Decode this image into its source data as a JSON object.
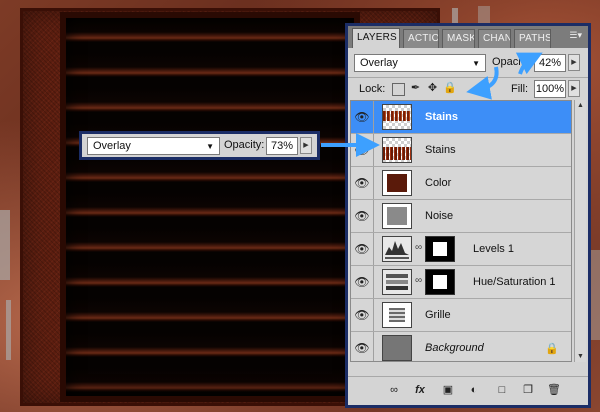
{
  "panel": {
    "tabs": [
      "LAYERS",
      "ACTIO",
      "MASK",
      "CHAN",
      "PATHS"
    ],
    "menu_icon": "panel-menu-icon",
    "blend_mode": "Overlay",
    "opacity_label": "Opacity:",
    "opacity_value": "42%",
    "lock_label": "Lock:",
    "fill_label": "Fill:",
    "fill_value": "100%",
    "layers": [
      {
        "name": "Stains",
        "thumb": "stains",
        "selected": true
      },
      {
        "name": "Stains",
        "thumb": "stains2",
        "selected": false
      },
      {
        "name": "Color",
        "thumb": "color",
        "selected": false
      },
      {
        "name": "Noise",
        "thumb": "noise",
        "selected": false
      },
      {
        "name": "Levels 1",
        "thumb": "levels",
        "selected": false
      },
      {
        "name": "Hue/Saturation 1",
        "thumb": "huesat",
        "selected": false
      },
      {
        "name": "Grille",
        "thumb": "grille",
        "selected": false
      },
      {
        "name": "Background",
        "thumb": "background",
        "selected": false,
        "locked": true
      }
    ],
    "footer_icons": [
      "link-layers-icon",
      "fx-icon",
      "add-mask-icon",
      "adjustment-layer-icon",
      "new-group-icon",
      "new-layer-icon",
      "delete-layer-icon"
    ]
  },
  "blend_box": {
    "blend_mode": "Overlay",
    "opacity_label": "Opacity:",
    "opacity_value": "73%"
  },
  "colors": {
    "panel_border": "#1b2d66",
    "selection": "#3d8ef7",
    "arrow": "#3da0ff"
  }
}
